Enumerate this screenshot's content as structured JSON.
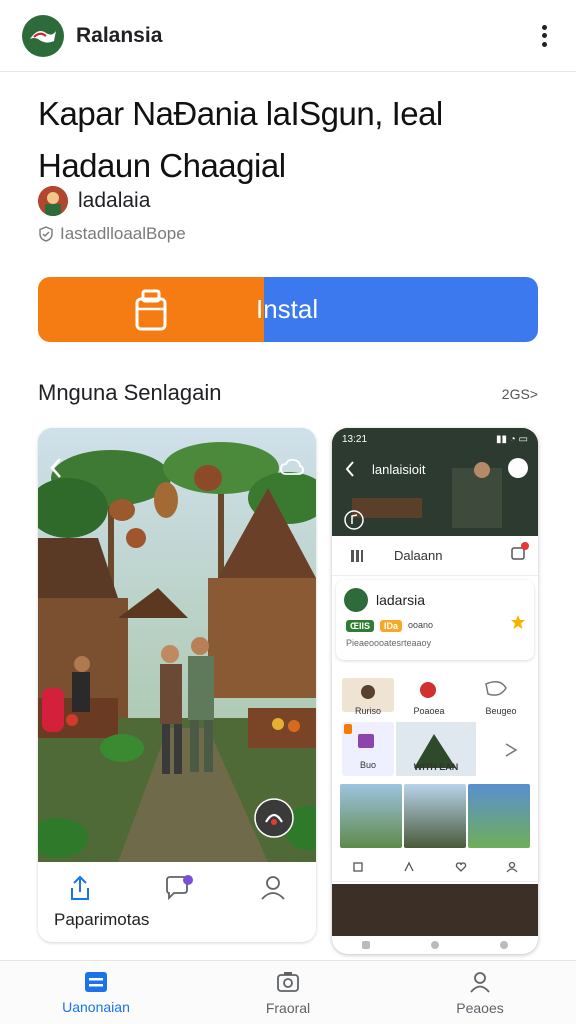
{
  "topbar": {
    "app_name": "Ralansia"
  },
  "title": {
    "line1": "Kapar NaÐania laISgun, Ieal",
    "line2": "Hadaun Chaagial"
  },
  "developer": {
    "name": "ladalaia",
    "verified_text": "IastadlloaalBope"
  },
  "install": {
    "label": "Instal",
    "left_color": "#f57c12",
    "right_color": "#3c78ee"
  },
  "screenshots_section": {
    "title": "Mnguna Senlagain",
    "more": "2GS>"
  },
  "card_left": {
    "bottom_label": "Paparimotas"
  },
  "phone": {
    "time": "13:21",
    "header_title": "lanlaisioit",
    "search_text": "Dalaann",
    "profile_name": "ladarsia",
    "tag1": "ŒIIS",
    "tag2": "IDa",
    "tag_text": "ooano",
    "profile_desc": "Pieaeoooatesrteaaoy",
    "tile_labels": [
      "Ruriso",
      "Poaoea",
      "Beugeo",
      "Buo",
      "WITH EAN"
    ]
  },
  "bottom_nav": [
    {
      "label": "Uanonaian",
      "icon": "apps-icon",
      "active": true
    },
    {
      "label": "Fraoral",
      "icon": "camera-icon",
      "active": false
    },
    {
      "label": "Peaoes",
      "icon": "person-icon",
      "active": false
    }
  ]
}
